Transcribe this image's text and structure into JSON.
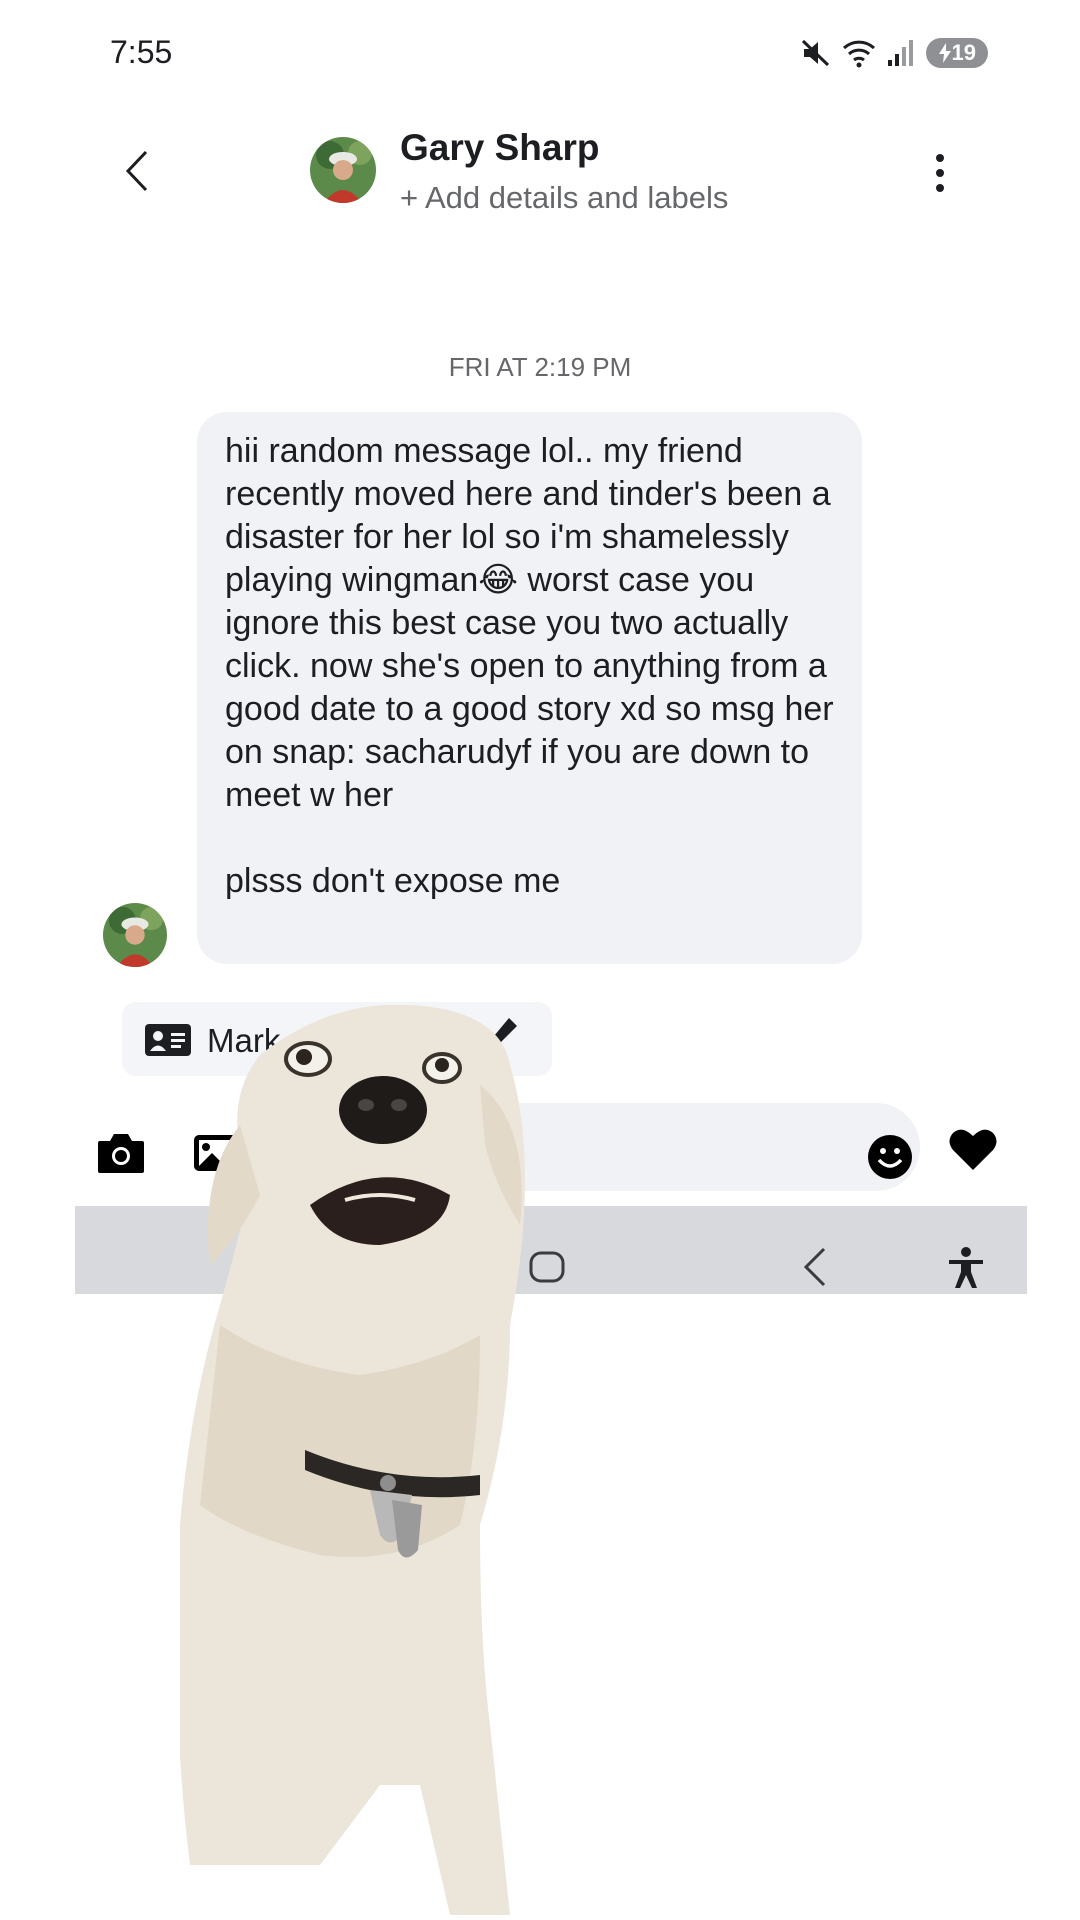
{
  "status_bar": {
    "time": "7:55",
    "battery": "19",
    "icons": [
      "mute-icon",
      "wifi-icon",
      "signal-icon",
      "battery-charging-icon"
    ]
  },
  "header": {
    "contact_name": "Gary Sharp",
    "add_details": "+ Add details and labels",
    "icons": [
      "back-icon",
      "more-icon"
    ]
  },
  "conversation": {
    "timestamp": "FRI AT 2:19 PM",
    "message": "hii random message lol.. my friend recently moved here and tinder's been a disaster for her lol so i'm shamelessly playing wingman😂 worst case you ignore this best case you two actually click. now she's open to anything from a good date to a good story xd so msg her on snap: sacharudyf if you are down to meet w her\n\nplsss don't expose me"
  },
  "mark_chip": {
    "label": "Mark"
  },
  "composer": {
    "icons": [
      "camera-icon",
      "gallery-icon",
      "emoji-icon",
      "heart-icon"
    ]
  },
  "nav_bar": {
    "icons": [
      "home-icon",
      "back-icon",
      "accessibility-icon"
    ]
  },
  "colors": {
    "bubble": "#f1f2f6",
    "nav_bar": "#d8d9dc",
    "secondary_text": "#65676b"
  }
}
